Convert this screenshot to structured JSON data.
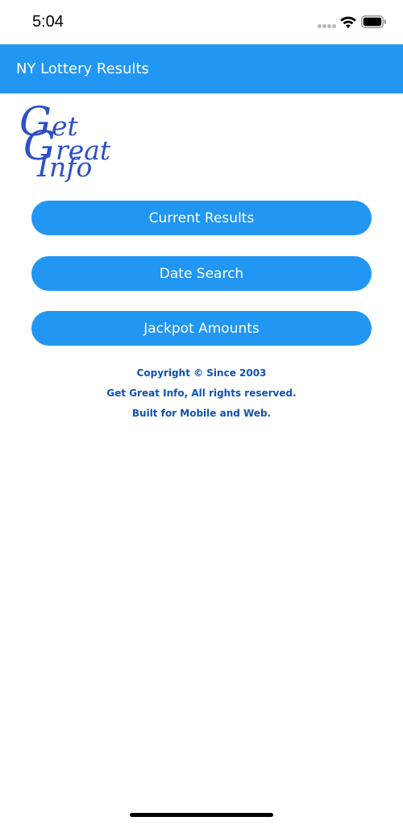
{
  "status_bar": {
    "time": "5:04"
  },
  "app_bar": {
    "title": "NY Lottery Results"
  },
  "logo": {
    "lines": [
      {
        "cap": "G",
        "rest": "et"
      },
      {
        "cap": "G",
        "rest": "reat"
      },
      {
        "cap": "I",
        "rest": "nfo"
      }
    ]
  },
  "menu": {
    "current_results": "Current Results",
    "date_search": "Date Search",
    "jackpot_amounts": "Jackpot Amounts"
  },
  "footer": {
    "copyright": "Copyright © Since 2003",
    "rights": "Get Great Info, All rights reserved.",
    "built": "Built for Mobile and Web."
  },
  "colors": {
    "primary": "#2196F3",
    "logo_blue": "#2D4FC7",
    "footer_text": "#0F52B5",
    "status_text": "#000000"
  },
  "icons": [
    "signal-dots-icon",
    "wifi-icon",
    "battery-icon"
  ]
}
